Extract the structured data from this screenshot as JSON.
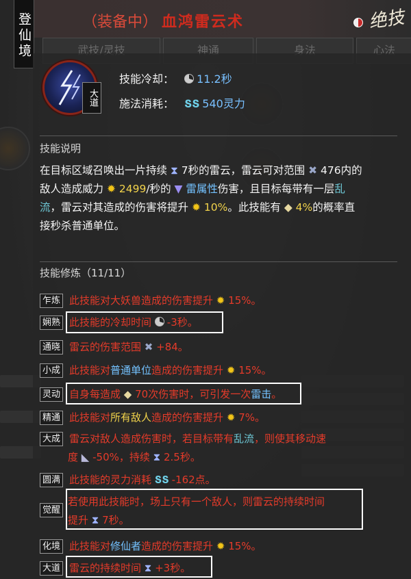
{
  "side_tab": "登仙境",
  "header": {
    "equip_status": "（装备中）",
    "skill_name": "血鸿雷云术",
    "ult_label": "绝技",
    "background_tabs": [
      "武技/灵技",
      "神通",
      "身法",
      "心法"
    ]
  },
  "skill": {
    "grade": "大道",
    "cooldown_label": "技能冷却：",
    "cooldown_value": "11.2秒",
    "cost_label": "施法消耗：",
    "cost_value": "540灵力"
  },
  "description": {
    "title": "技能说明",
    "line1_a": "在目标区域召唤出一片持续",
    "line1_b": "7秒的雷云，雷云可对范围",
    "line1_c": "476内的",
    "line2_a": "敌人造成威力",
    "line2_b": "2499",
    "line2_c": "/秒的",
    "line2_d": "雷属性",
    "line2_e": "伤害，且目标每带有一层",
    "line2_f": "乱",
    "line3_a": "流",
    "line3_b": "，雷云对其造成的伤害将提升",
    "line3_c": "10%",
    "line3_d": "。此技能有",
    "line3_e": "4%",
    "line3_f": "的概率直",
    "line4": "接秒杀普通单位。"
  },
  "training": {
    "title": "技能修炼（11/11）",
    "rows": [
      {
        "tag": "乍炼",
        "a": "此技能对大妖兽造成的伤害提升",
        "b": "15%。"
      },
      {
        "tag": "娴熟",
        "a": "此技能的冷却时间",
        "b": "-3秒。"
      },
      {
        "tag": "通晓",
        "a": "雷云的伤害范围",
        "b": "+84。"
      },
      {
        "tag": "小成",
        "a": "此技能对",
        "hl": "普通单位",
        "a2": "造成的伤害提升",
        "b": "15%。"
      },
      {
        "tag": "灵动",
        "a": "自身每造成",
        "b": "70次伤害时，可引发一次",
        "hl": "雷击",
        "c": "。"
      },
      {
        "tag": "精通",
        "a": "此技能对",
        "hl": "所有敌人",
        "a2": "造成的伤害提升",
        "b": "7%。"
      },
      {
        "tag": "大成",
        "a": "雷云对敌人造成伤害时，若目标带有",
        "hl": "乱流",
        "a2": "，则使其移动速",
        "l2a": "度",
        "l2b": "-50%，持续",
        "l2c": "2.5秒。"
      },
      {
        "tag": "圆满",
        "a": "此技能的灵力消耗",
        "b": "-162点。"
      },
      {
        "tag": "觉醒",
        "a": "若使用此技能时，场上只有一个敌人，则雷云的持续时间",
        "l2a": "提升",
        "l2b": "7秒。"
      },
      {
        "tag": "化境",
        "a": "此技能对",
        "hl": "修仙者",
        "a2": "造成的伤害提升",
        "b": "15%。"
      },
      {
        "tag": "大道",
        "a": "雷云的持续时间",
        "b": "+3秒。"
      }
    ]
  },
  "colors": {
    "title_red": "#d02b1e",
    "effect_red": "#e53b2a",
    "keyword_blue": "#74c2ff",
    "number_yellow": "#f2d34b",
    "debuff_cyan": "#6ec8d6"
  }
}
